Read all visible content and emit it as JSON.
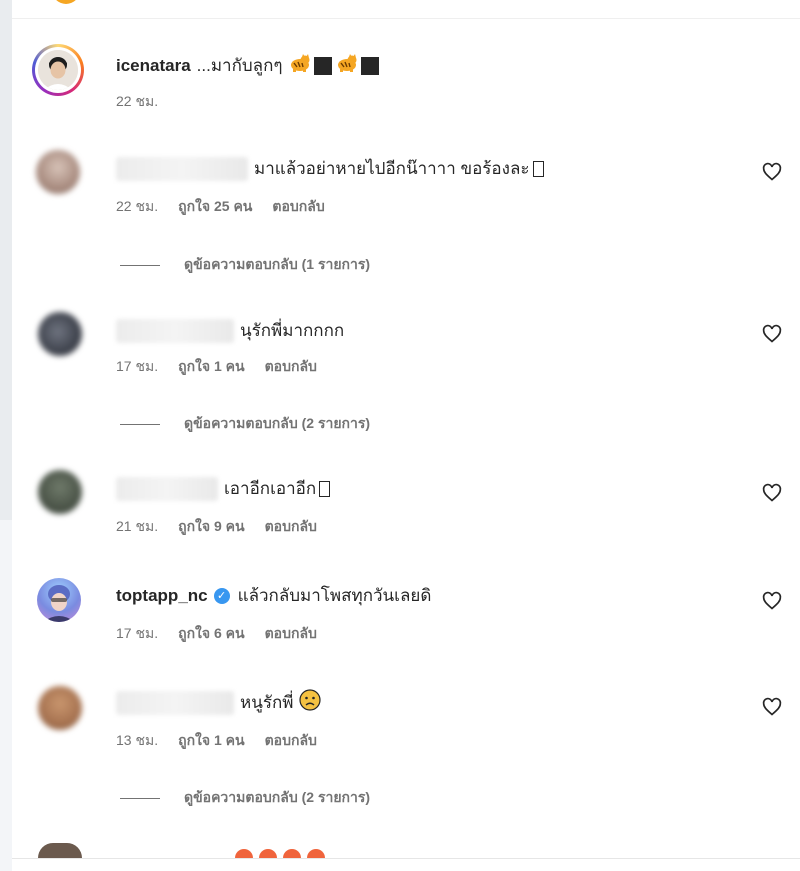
{
  "comments": [
    {
      "username": "icenatara",
      "text": "...มากับลูกๆ",
      "time": "22 ชม.",
      "icons": [
        "cat-icon",
        "black-square",
        "cat-icon",
        "black-square"
      ]
    },
    {
      "username": "",
      "text": "มาแล้วอย่าหายไปอีกน๊าาาา ขอร้องละ",
      "time": "22 ชม.",
      "likes": "ถูกใจ 25 คน",
      "reply": "ตอบกลับ",
      "view_replies": "ดูข้อความตอบกลับ (1 รายการ)"
    },
    {
      "username": "",
      "text": "นุรักพี่มากกกก",
      "time": "17 ชม.",
      "likes": "ถูกใจ 1 คน",
      "reply": "ตอบกลับ",
      "view_replies": "ดูข้อความตอบกลับ (2 รายการ)"
    },
    {
      "username": "",
      "text": "เอาอีกเอาอีก",
      "time": "21 ชม.",
      "likes": "ถูกใจ 9 คน",
      "reply": "ตอบกลับ"
    },
    {
      "username": "toptapp_nc",
      "text": "แล้วกลับมาโพสทุกวันเลยดิ",
      "time": "17 ชม.",
      "likes": "ถูกใจ 6 คน",
      "reply": "ตอบกลับ",
      "verified": true
    },
    {
      "username": "",
      "text": "หนูรักพี่",
      "time": "13 ชม.",
      "likes": "ถูกใจ 1 คน",
      "reply": "ตอบกลับ",
      "view_replies": "ดูข้อความตอบกลับ (2 รายการ)"
    }
  ],
  "colors": {
    "text": "#262626",
    "secondary": "#737373",
    "verified": "#3897f0"
  }
}
